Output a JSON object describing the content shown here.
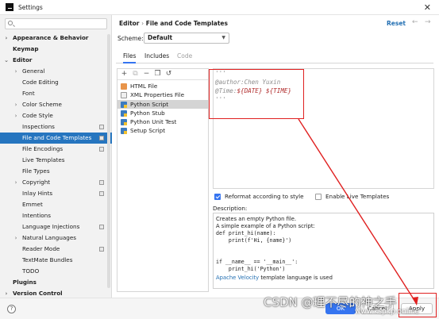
{
  "window": {
    "title": "Settings",
    "close_glyph": "✕"
  },
  "sidebar": {
    "items": [
      {
        "label": "Appearance & Behavior",
        "bold": true,
        "chevron": "›",
        "level": 0
      },
      {
        "label": "Keymap",
        "bold": true,
        "chevron": "",
        "level": 0
      },
      {
        "label": "Editor",
        "bold": true,
        "chevron": "⌄",
        "level": 0
      },
      {
        "label": "General",
        "bold": false,
        "chevron": "›",
        "level": 1
      },
      {
        "label": "Code Editing",
        "bold": false,
        "chevron": "",
        "level": 1
      },
      {
        "label": "Font",
        "bold": false,
        "chevron": "",
        "level": 1
      },
      {
        "label": "Color Scheme",
        "bold": false,
        "chevron": "›",
        "level": 1
      },
      {
        "label": "Code Style",
        "bold": false,
        "chevron": "›",
        "level": 1
      },
      {
        "label": "Inspections",
        "bold": false,
        "chevron": "",
        "level": 1,
        "project": true
      },
      {
        "label": "File and Code Templates",
        "bold": false,
        "chevron": "",
        "level": 1,
        "selected": true,
        "project": true
      },
      {
        "label": "File Encodings",
        "bold": false,
        "chevron": "",
        "level": 1,
        "project": true
      },
      {
        "label": "Live Templates",
        "bold": false,
        "chevron": "",
        "level": 1
      },
      {
        "label": "File Types",
        "bold": false,
        "chevron": "",
        "level": 1
      },
      {
        "label": "Copyright",
        "bold": false,
        "chevron": "›",
        "level": 1,
        "project": true
      },
      {
        "label": "Inlay Hints",
        "bold": false,
        "chevron": "",
        "level": 1,
        "project": true
      },
      {
        "label": "Emmet",
        "bold": false,
        "chevron": "",
        "level": 1
      },
      {
        "label": "Intentions",
        "bold": false,
        "chevron": "",
        "level": 1
      },
      {
        "label": "Language Injections",
        "bold": false,
        "chevron": "",
        "level": 1,
        "project": true
      },
      {
        "label": "Natural Languages",
        "bold": false,
        "chevron": "›",
        "level": 1
      },
      {
        "label": "Reader Mode",
        "bold": false,
        "chevron": "",
        "level": 1,
        "project": true
      },
      {
        "label": "TextMate Bundles",
        "bold": false,
        "chevron": "",
        "level": 1
      },
      {
        "label": "TODO",
        "bold": false,
        "chevron": "",
        "level": 1
      },
      {
        "label": "Plugins",
        "bold": true,
        "chevron": "",
        "level": 0
      },
      {
        "label": "Version Control",
        "bold": true,
        "chevron": "›",
        "level": 0
      }
    ]
  },
  "header": {
    "crumb_parent": "Editor",
    "crumb_sep": "›",
    "crumb_current": "File and Code Templates",
    "reset": "Reset",
    "back_glyph": "←",
    "forward_glyph": "→"
  },
  "scheme": {
    "label": "Scheme:",
    "value": "Default",
    "caret": "▼"
  },
  "tabs": [
    "Files",
    "Includes",
    "Code"
  ],
  "toolbar": {
    "add": "+",
    "copy_template": "⧉",
    "remove": "−",
    "duplicate": "❐",
    "reset": "↺"
  },
  "templates": [
    {
      "label": "HTML File",
      "icon": "html"
    },
    {
      "label": "XML Properties File",
      "icon": "xml"
    },
    {
      "label": "Python Script",
      "icon": "py",
      "selected": true
    },
    {
      "label": "Python Stub",
      "icon": "py"
    },
    {
      "label": "Python Unit Test",
      "icon": "py"
    },
    {
      "label": "Setup Script",
      "icon": "py"
    }
  ],
  "editor": {
    "line1": "'''",
    "line2": "@author:Chen Yuxin",
    "line3_prefix": "@Time:",
    "var_date": "${DATE}",
    "var_time": "${TIME}",
    "line4": "'''"
  },
  "options": {
    "reformat_label": "Reformat according to style",
    "reformat_checked": true,
    "live_templates_label": "Enable Live Templates",
    "live_templates_checked": false
  },
  "description": {
    "label": "Description:",
    "lines": [
      "Creates an empty Python file.",
      "A simple example of a Python script:",
      "def print_hi(name):",
      "    print(f'Hi, {name}')",
      "",
      "",
      "if __name__ == '__main__':",
      "    print_hi('Python')"
    ],
    "footer_link": "Apache Velocity",
    "footer_text": " template language is used"
  },
  "buttons": {
    "help": "?",
    "ok": "OK",
    "cancel": "Cancel",
    "apply": "Apply"
  },
  "watermark": {
    "text": "CSDN @理不尽的神之手",
    "url": "www.kspkp.online"
  },
  "colors": {
    "accent": "#3574f0",
    "selection": "#2675bf",
    "annotation": "#e02020",
    "template_var": "#b02b2b"
  }
}
